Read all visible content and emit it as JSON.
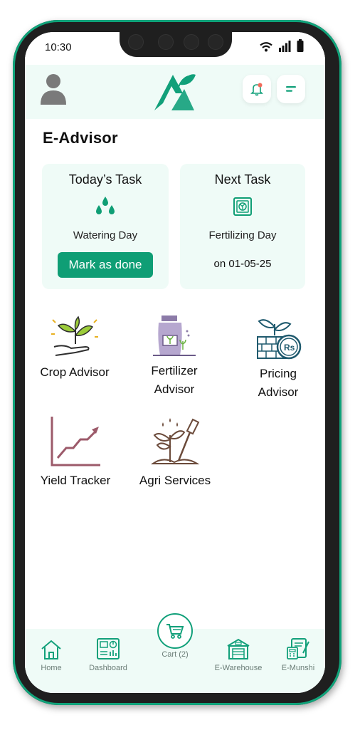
{
  "status_bar": {
    "time": "10:30"
  },
  "header": {
    "app_logo": "agri-leaf-logo"
  },
  "page": {
    "title": "E-Advisor"
  },
  "today_task": {
    "heading": "Today’s Task",
    "task": "Watering Day",
    "button_label": "Mark as done"
  },
  "next_task": {
    "heading": "Next Task",
    "task": "Fertilizing Day",
    "date": "on 01-05-25"
  },
  "advisors": [
    {
      "line1": "Crop Advisor",
      "line2": ""
    },
    {
      "line1": "Fertilizer",
      "line2": "Advisor"
    },
    {
      "line1": "Pricing",
      "line2": "Advisor"
    },
    {
      "line1": "Yield Tracker",
      "line2": ""
    },
    {
      "line1": "Agri Services",
      "line2": ""
    }
  ],
  "bottom_nav": {
    "home": "Home",
    "dashboard": "Dashboard",
    "cart": "Cart (2)",
    "warehouse": "E-Warehouse",
    "munshi": "E-Munshi"
  },
  "colors": {
    "accent": "#0f9e75",
    "header_bg": "#effbf7",
    "yield_line": "#9c5a6a"
  }
}
